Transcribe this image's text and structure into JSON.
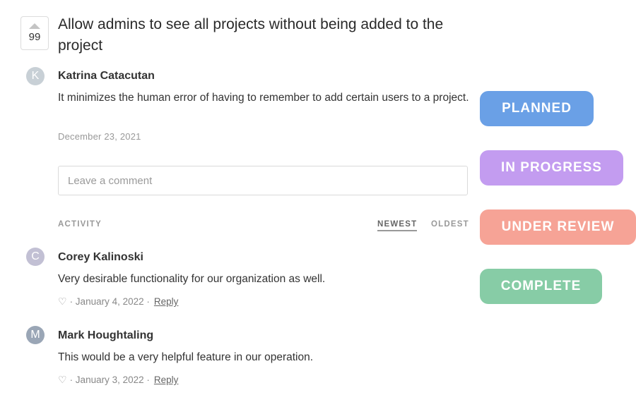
{
  "post": {
    "vote_count": "99",
    "title": "Allow admins to see all projects without being added to the project",
    "author_initial": "K",
    "author_name": "Katrina Catacutan",
    "body": "It minimizes the human error of having to remember to add certain users to a project.",
    "date": "December 23, 2021"
  },
  "comment_box": {
    "placeholder": "Leave a comment"
  },
  "activity": {
    "label": "ACTIVITY",
    "sort_newest": "NEWEST",
    "sort_oldest": "OLDEST"
  },
  "comments": [
    {
      "initial": "C",
      "author": "Corey Kalinoski",
      "text": "Very desirable functionality for our organization as well.",
      "date": "· January 4, 2022 ·",
      "reply": "Reply"
    },
    {
      "initial": "M",
      "author": "Mark Houghtaling",
      "text": "This would be a very helpful feature in our operation.",
      "date": "· January 3, 2022 ·",
      "reply": "Reply"
    }
  ],
  "statuses": [
    {
      "label": "PLANNED",
      "color": "#6aa0e6"
    },
    {
      "label": "IN PROGRESS",
      "color": "#c39cf0"
    },
    {
      "label": "UNDER REVIEW",
      "color": "#f6a396"
    },
    {
      "label": "COMPLETE",
      "color": "#87cca6"
    }
  ],
  "colors": {
    "avatar_k": "#c8d0d6",
    "avatar_c": "#c2c0d4",
    "avatar_m": "#9aa6b6"
  }
}
